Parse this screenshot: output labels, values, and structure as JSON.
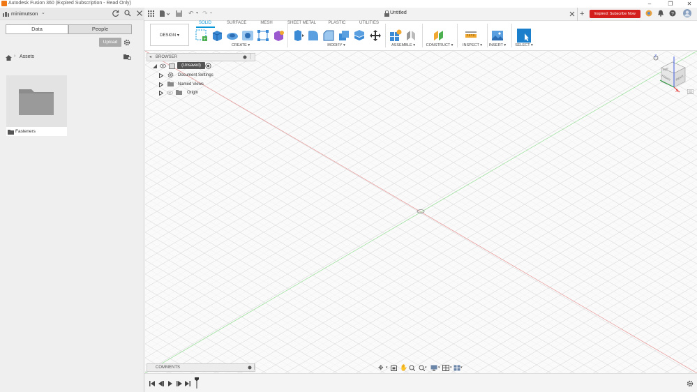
{
  "window": {
    "title": "Autodesk Fusion 360 (Expired Subscription - Read Only)",
    "controls": {
      "minimize": "–",
      "restore": "❐",
      "close": "✕"
    }
  },
  "data_panel": {
    "team": "minimutson",
    "tabs": [
      {
        "label": "Data",
        "active": true
      },
      {
        "label": "People",
        "active": false
      }
    ],
    "upload_label": "Upload",
    "breadcrumb": "Assets",
    "folders": [
      {
        "name": "Fasteners"
      }
    ]
  },
  "doc_tabs": {
    "title": "Untitled",
    "expired_label": "Expired: Subscribe Now"
  },
  "ribbon": {
    "workspace": "DESIGN ▾",
    "tabs": [
      {
        "label": "SOLID",
        "active": true
      },
      {
        "label": "SURFACE"
      },
      {
        "label": "MESH"
      },
      {
        "label": "SHEET METAL"
      },
      {
        "label": "PLASTIC"
      },
      {
        "label": "UTILITIES"
      }
    ],
    "groups": [
      "CREATE ▾",
      "MODIFY ▾",
      "ASSEMBLE ▾",
      "CONSTRUCT ▾",
      "INSPECT ▾",
      "INSERT ▾",
      "SELECT ▾"
    ]
  },
  "browser": {
    "title": "BROWSER",
    "root": "(Unsaved)",
    "items": [
      "Document Settings",
      "Named Views",
      "Origin"
    ]
  },
  "comments": {
    "title": "COMMENTS"
  },
  "viewcube": {
    "faces": [
      "TOP",
      "FRONT",
      "RIGHT"
    ],
    "axes": [
      "Z",
      "X"
    ]
  },
  "colors": {
    "accent": "#0696d7",
    "expired": "#d41e1e",
    "x_axis": "#e88",
    "y_axis": "#8d8",
    "brand": "#f07814"
  }
}
